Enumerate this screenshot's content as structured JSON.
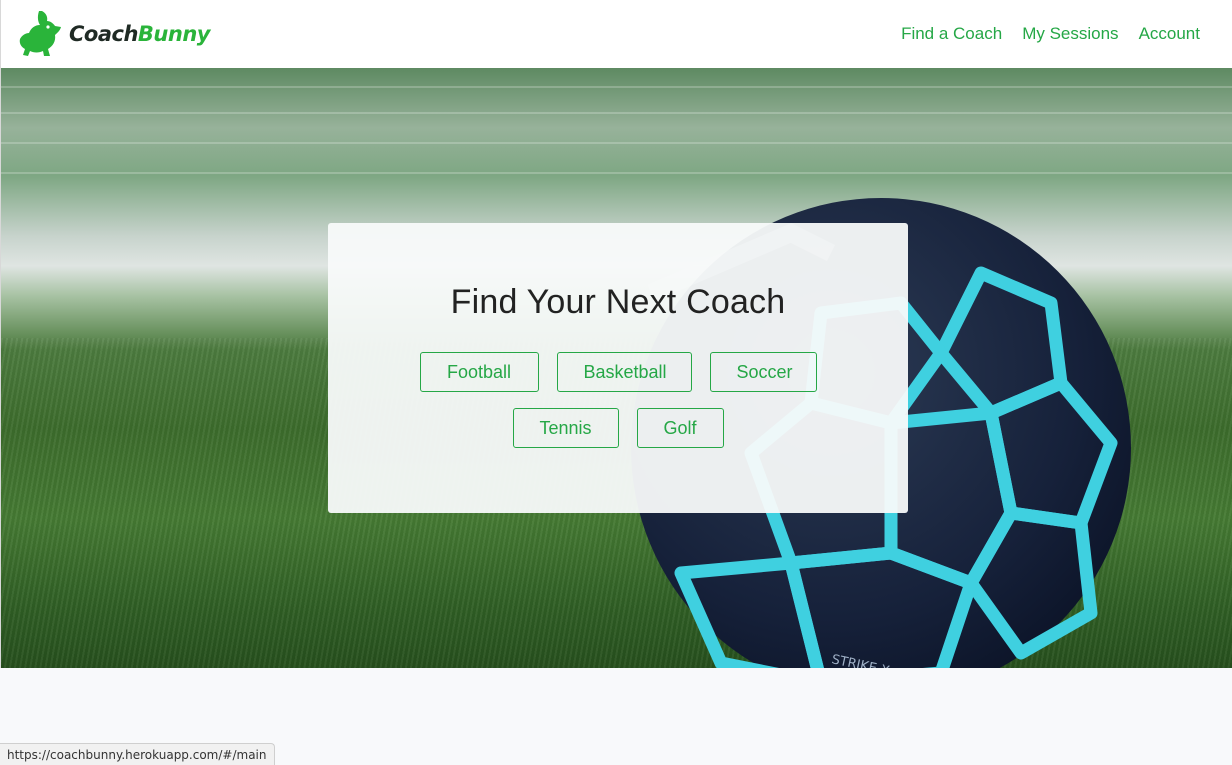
{
  "brand": {
    "name_part1": "Coach",
    "name_part2": "Bunny",
    "logo_icon": "rabbit-logo-icon",
    "accent_color": "#2ab43a"
  },
  "nav": {
    "items": [
      {
        "label": "Find a Coach"
      },
      {
        "label": "My Sessions"
      },
      {
        "label": "Account"
      }
    ]
  },
  "hero": {
    "card_title": "Find Your Next Coach",
    "sports_row1": [
      {
        "label": "Football"
      },
      {
        "label": "Basketball"
      },
      {
        "label": "Soccer"
      }
    ],
    "sports_row2": [
      {
        "label": "Tennis"
      },
      {
        "label": "Golf"
      }
    ]
  },
  "status_bar": {
    "url": "https://coachbunny.herokuapp.com/#/main"
  }
}
